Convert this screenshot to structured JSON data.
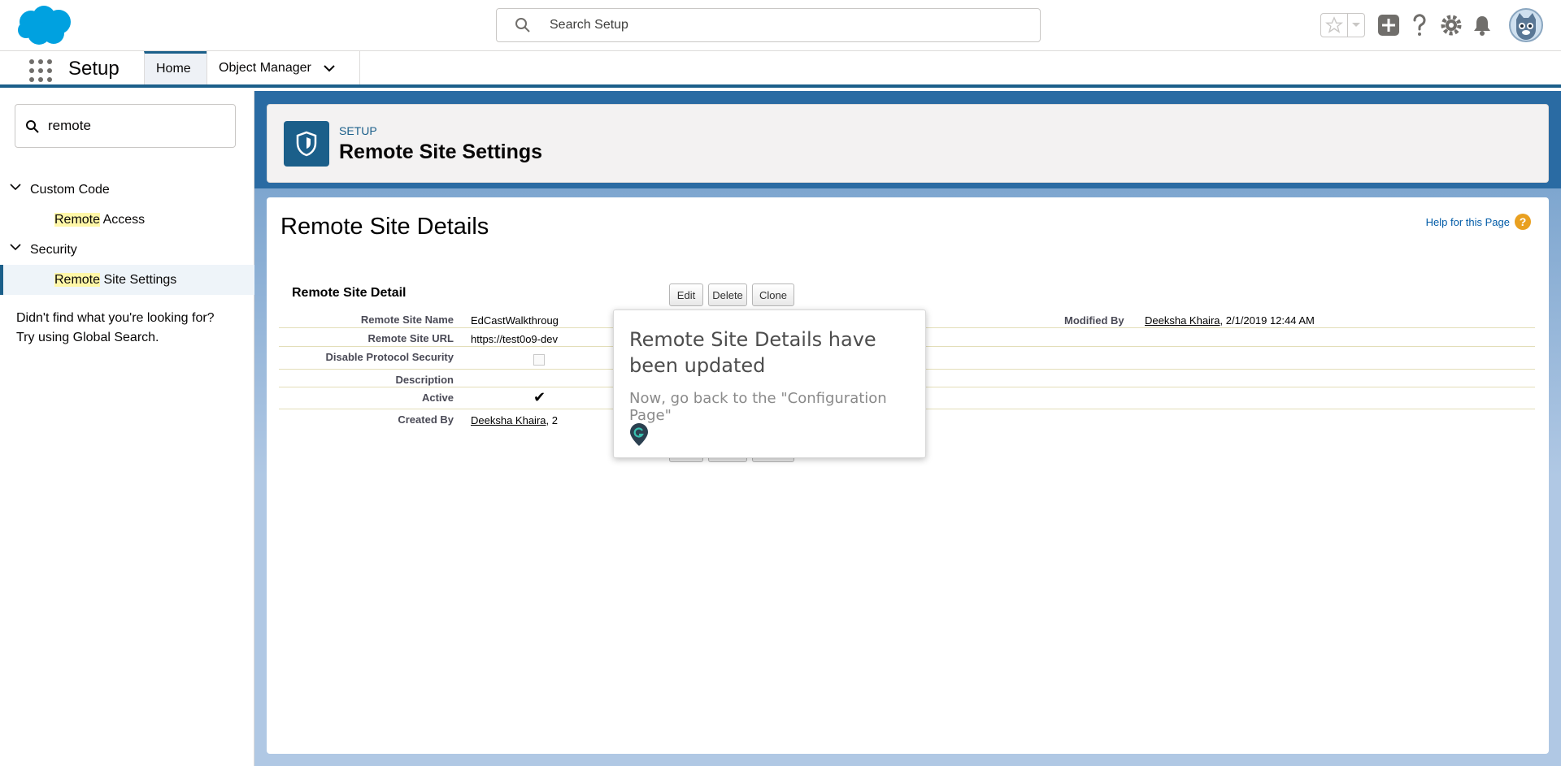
{
  "header": {
    "search_placeholder": "Search Setup",
    "icons": [
      "favorites-star-icon",
      "favorites-dropdown-icon",
      "global-actions-plus-icon",
      "help-question-icon",
      "setup-gear-icon",
      "notifications-bell-icon",
      "user-avatar"
    ]
  },
  "context_bar": {
    "app_name": "Setup",
    "tabs": [
      {
        "label": "Home"
      },
      {
        "label": "Object Manager"
      }
    ]
  },
  "sidebar": {
    "quickfind_value": "remote",
    "groups": [
      {
        "label": "Custom Code",
        "children": [
          {
            "highlight": "Remote",
            "rest": " Access"
          }
        ]
      },
      {
        "label": "Security",
        "children": [
          {
            "highlight": "Remote",
            "rest": " Site Settings"
          }
        ]
      }
    ],
    "help_text_1": "Didn't find what you're looking for?",
    "help_text_2": "Try using Global Search."
  },
  "page_header": {
    "eyebrow": "SETUP",
    "title": "Remote Site Settings"
  },
  "content": {
    "title": "Remote Site Details",
    "help_link": "Help for this Page",
    "section_title": "Remote Site Detail",
    "buttons": {
      "edit": "Edit",
      "delete": "Delete",
      "clone": "Clone"
    },
    "fields": {
      "name_label": "Remote Site Name",
      "name_value": "EdCastWalkthroug",
      "url_label": "Remote Site URL",
      "url_value": "https://test0o9-dev",
      "disable_label": "Disable Protocol Security",
      "description_label": "Description",
      "active_label": "Active",
      "created_label": "Created By",
      "created_user": "Deeksha Khaira",
      "created_suffix": ", 2",
      "modified_label": "Modified By",
      "modified_user": "Deeksha Khaira",
      "modified_date": ", 2/1/2019 12:44 AM"
    }
  },
  "popup": {
    "title": "Remote Site Details have been updated",
    "body": "Now, go back to the \"Configuration Page\""
  },
  "colors": {
    "brand_blue": "#1b5f8a",
    "link_blue": "#015ba7",
    "highlight_yellow": "#fff7a8"
  }
}
